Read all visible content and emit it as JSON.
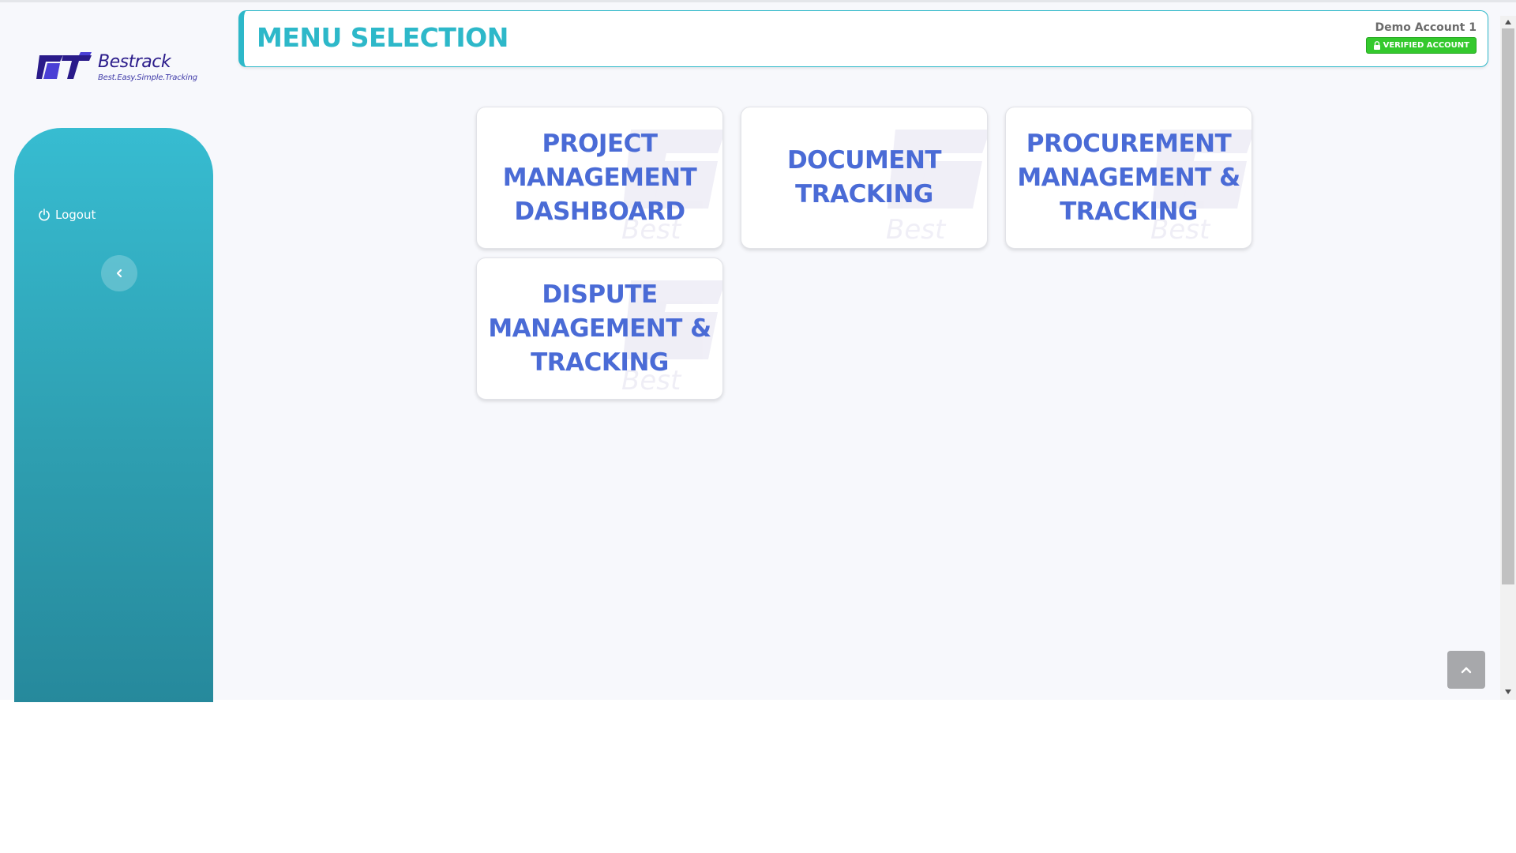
{
  "logo": {
    "name": "Bestrack",
    "tagline": "Best.Easy.Simple.Tracking",
    "colors": {
      "primary": "#2a1b8a",
      "secondary": "#4a3fd6"
    }
  },
  "sidebar": {
    "logout_label": "Logout",
    "logout_icon": "power-icon",
    "collapse_icon": "chevron-left-icon",
    "colors": {
      "top": "#37bcd1",
      "bottom": "#26899c"
    }
  },
  "header": {
    "title": "MENU SELECTION",
    "account_name": "Demo Account 1",
    "verified_label": "VERIFIED ACCOUNT",
    "verified_icon": "lock-icon",
    "accent_color": "#2db8c9",
    "verified_color": "#34c92d"
  },
  "menu": {
    "text_color": "#4a6bd6",
    "cards": [
      {
        "label": "PROJECT MANAGEMENT DASHBOARD"
      },
      {
        "label": "DOCUMENT TRACKING"
      },
      {
        "label": "PROCUREMENT MANAGEMENT & TRACKING"
      },
      {
        "label": "DISPUTE MANAGEMENT & TRACKING"
      }
    ]
  },
  "controls": {
    "back_to_top_icon": "chevron-up-icon",
    "scroll_up_icon": "scroll-up-arrow-icon",
    "scroll_down_icon": "scroll-down-arrow-icon"
  }
}
